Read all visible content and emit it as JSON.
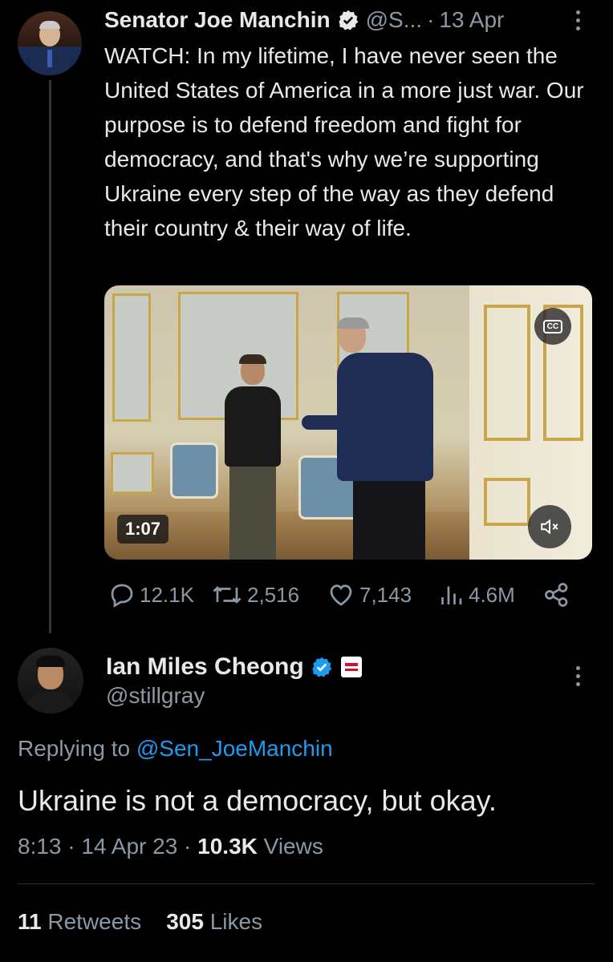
{
  "tweet1": {
    "display_name": "Senator Joe Manchin",
    "handle": "@S...",
    "separator": "·",
    "date": "13 Apr",
    "text": "WATCH: In my lifetime, I have never seen the United States of America in a more just war. Our purpose is to defend freedom and fight for democracy, and that's why we’re supporting Ukraine every step of the way as they defend their country & their way of life.",
    "video": {
      "duration": "1:07",
      "captions_label": "CC"
    },
    "replies": "12.1K",
    "retweets": "2,516",
    "likes": "7,143",
    "views": "4.6M"
  },
  "tweet2": {
    "display_name": "Ian Miles Cheong",
    "handle": "@stillgray",
    "replying_prefix": "Replying to",
    "replying_to": "@Sen_JoeManchin",
    "text": "Ukraine is not a democracy, but okay.",
    "time": "8:13",
    "date": "14 Apr 23",
    "views_count": "10.3K",
    "views_label": "Views",
    "retweets_count": "11",
    "retweets_label": "Retweets",
    "likes_count": "305",
    "likes_label": "Likes"
  },
  "colors": {
    "background": "#000000",
    "text_primary": "#e7e9ea",
    "text_secondary": "#8b98a5",
    "accent": "#1d9bf0",
    "divider": "#2f3336"
  },
  "icons": [
    "more-icon",
    "verified-icon",
    "reply-icon",
    "retweet-icon",
    "like-icon",
    "views-icon",
    "share-icon",
    "captions-icon",
    "mute-icon",
    "affiliate-badge-icon"
  ]
}
